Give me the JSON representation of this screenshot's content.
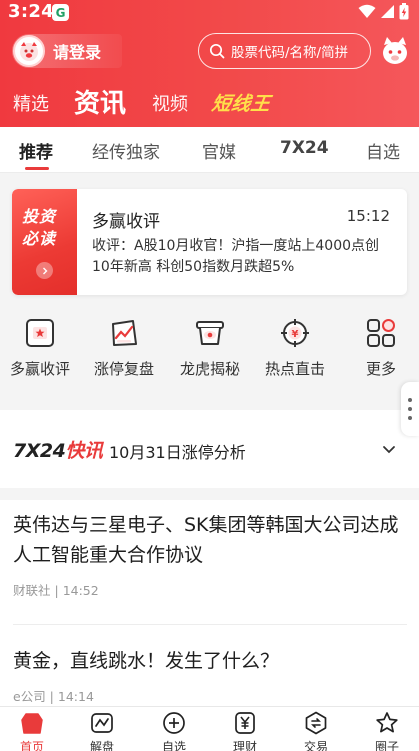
{
  "status_bar": {
    "time": "3:24",
    "notif_glyph": "G"
  },
  "header": {
    "login_label": "请登录",
    "search_placeholder": "股票代码/名称/简拼",
    "top_tabs": [
      "精选",
      "资讯",
      "视频",
      "短线王"
    ],
    "active_top_tab": "资讯",
    "brand_color": "#f0393f",
    "highlight_color": "#ffe04a"
  },
  "sub_tabs": {
    "items": [
      "推荐",
      "经传独家",
      "官媒",
      "7X24",
      "自选"
    ],
    "active": "推荐"
  },
  "featured": {
    "badge_line1": "投资",
    "badge_line2": "必读",
    "title": "多赢收评",
    "time": "15:12",
    "summary": "收评：A股10月收官！沪指一度站上4000点创10年新高 科创50指数月跌超5%"
  },
  "shortcuts": [
    {
      "label": "多赢收评",
      "icon": "review-icon"
    },
    {
      "label": "涨停复盘",
      "icon": "chart-trend-icon"
    },
    {
      "label": "龙虎揭秘",
      "icon": "pot-icon"
    },
    {
      "label": "热点直击",
      "icon": "target-icon"
    },
    {
      "label": "更多",
      "icon": "grid-more-icon"
    }
  ],
  "flash": {
    "logo_a": "7X24",
    "logo_b": "快讯",
    "headline": "10月31日涨停分析"
  },
  "articles": [
    {
      "title": "英伟达与三星电子、SK集团等韩国大公司达成人工智能重大合作协议",
      "source": "财联社",
      "time": "14:52"
    },
    {
      "title": "黄金，直线跳水！发生了什么？",
      "source": "e公司",
      "time": "14:14"
    }
  ],
  "bottom_nav": [
    {
      "label": "首页",
      "icon": "home-icon"
    },
    {
      "label": "解盘",
      "icon": "chart-wave-icon"
    },
    {
      "label": "自选",
      "icon": "plus-circle-icon"
    },
    {
      "label": "理财",
      "icon": "yen-icon"
    },
    {
      "label": "交易",
      "icon": "trade-icon"
    },
    {
      "label": "圈子",
      "icon": "star-icon"
    }
  ],
  "active_bottom": "首页"
}
